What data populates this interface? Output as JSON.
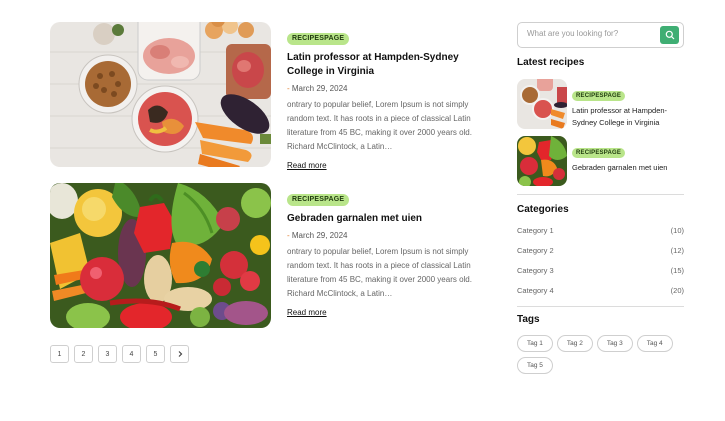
{
  "posts": [
    {
      "badge": "RECIPESPAGE",
      "title": "Latin professor at Hampden-Sydney College in Virginia",
      "date": "March 29, 2024",
      "excerpt": "ontrary to popular belief, Lorem Ipsum is not simply random text. It has roots in a piece of classical Latin literature from 45 BC, making it over 2000 years old. Richard McClintock, a Latin…",
      "read_more": "Read more",
      "image_icon": "meat-and-vegetables-photo"
    },
    {
      "badge": "RECIPESPAGE",
      "title": "Gebraden garnalen met uien",
      "date": "March 29, 2024",
      "excerpt": "ontrary to popular belief, Lorem Ipsum is not simply random text. It has roots in a piece of classical Latin literature from 45 BC, making it over 2000 years old. Richard McClintock, a Latin…",
      "read_more": "Read more",
      "image_icon": "vegetables-photo"
    }
  ],
  "pagination": {
    "pages": [
      "1",
      "2",
      "3",
      "4",
      "5"
    ],
    "next_icon": "chevron-right-icon"
  },
  "sidebar": {
    "search": {
      "placeholder": "What are you looking for?",
      "button_icon": "search-icon"
    },
    "latest_title": "Latest recipes",
    "latest": [
      {
        "badge": "RECIPESPAGE",
        "title": "Latin professor at Hampden-Sydney College in Virginia"
      },
      {
        "badge": "RECIPESPAGE",
        "title": "Gebraden garnalen met uien"
      }
    ],
    "categories_title": "Categories",
    "categories": [
      {
        "name": "Category 1",
        "count": "(10)"
      },
      {
        "name": "Category 2",
        "count": "(12)"
      },
      {
        "name": "Category 3",
        "count": "(15)"
      },
      {
        "name": "Category 4",
        "count": "(20)"
      }
    ],
    "tags_title": "Tags",
    "tags": [
      "Tag 1",
      "Tag 2",
      "Tag 3",
      "Tag 4",
      "Tag 5"
    ]
  },
  "colors": {
    "badge_bg": "#b9e58a",
    "search_button": "#3fae73",
    "date_dash": "#e07a2b"
  }
}
